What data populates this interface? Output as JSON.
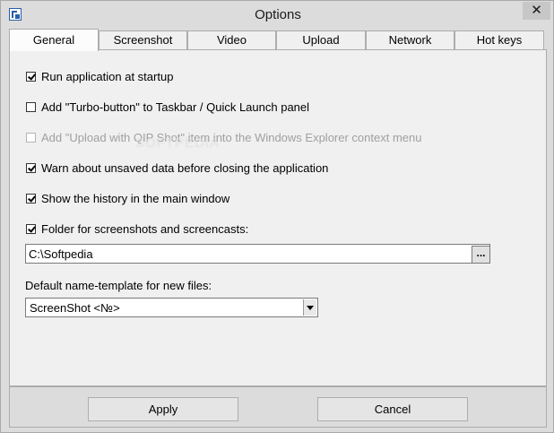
{
  "window": {
    "title": "Options",
    "app_icon": "app-logo-icon",
    "close_label": "✕"
  },
  "tabs": [
    {
      "label": "General",
      "active": true
    },
    {
      "label": "Screenshot",
      "active": false
    },
    {
      "label": "Video",
      "active": false
    },
    {
      "label": "Upload",
      "active": false
    },
    {
      "label": "Network",
      "active": false
    },
    {
      "label": "Hot keys",
      "active": false
    }
  ],
  "general": {
    "options": [
      {
        "label": "Run application at startup",
        "checked": true,
        "enabled": true
      },
      {
        "label": "Add \"Turbo-button\" to Taskbar / Quick Launch panel",
        "checked": false,
        "enabled": true
      },
      {
        "label": "Add \"Upload with QIP Shot\" item into the Windows Explorer context menu",
        "checked": false,
        "enabled": false
      },
      {
        "label": "Warn about unsaved data before closing the application",
        "checked": true,
        "enabled": true
      },
      {
        "label": "Show the history in the main window",
        "checked": true,
        "enabled": true
      },
      {
        "label": "Folder for screenshots and screencasts:",
        "checked": true,
        "enabled": true
      }
    ],
    "folder_path": "C:\\Softpedia",
    "browse_label": "...",
    "template_label": "Default name-template for new files:",
    "template_value": "ScreenShot <№>"
  },
  "watermark": "SOFTPEDIA",
  "footer": {
    "apply_label": "Apply",
    "cancel_label": "Cancel"
  }
}
